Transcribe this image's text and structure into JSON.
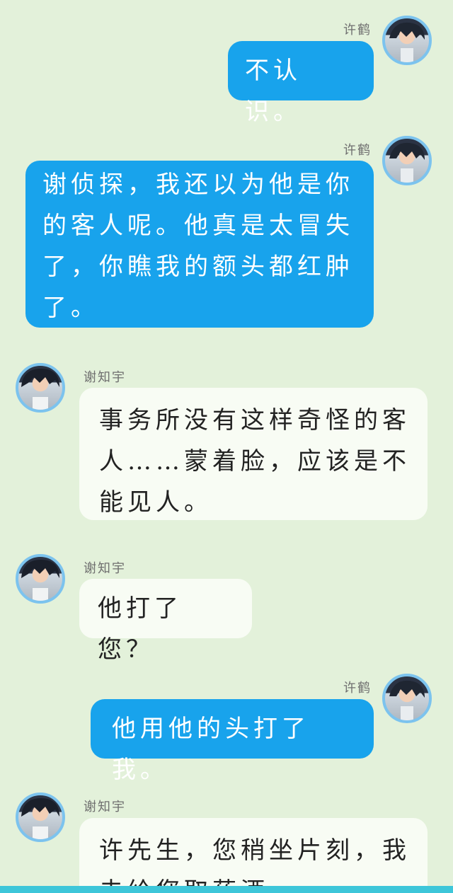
{
  "messages": [
    {
      "side": "right",
      "name": "许鹤",
      "text": "不认识。"
    },
    {
      "side": "right",
      "name": "许鹤",
      "text": "谢侦探，我还以为他是你的客人呢。他真是太冒失了，你瞧我的额头都红肿了。"
    },
    {
      "side": "left",
      "name": "谢知宇",
      "text": "事务所没有这样奇怪的客人……蒙着脸，应该是不能见人。"
    },
    {
      "side": "left",
      "name": "谢知宇",
      "text": "他打了您？"
    },
    {
      "side": "right",
      "name": "许鹤",
      "text": "他用他的头打了我。"
    },
    {
      "side": "left",
      "name": "谢知宇",
      "text": "许先生，您稍坐片刻，我去给您取药酒"
    }
  ],
  "colors": {
    "background": "#e3f1da",
    "right_bubble": "#18a3ec",
    "left_bubble": "#f8fcf4",
    "avatar_ring": "#7cc3ee"
  },
  "icons": {
    "right_avatar": "avatar-xu-he",
    "left_avatar": "avatar-xie-zhiyu"
  }
}
